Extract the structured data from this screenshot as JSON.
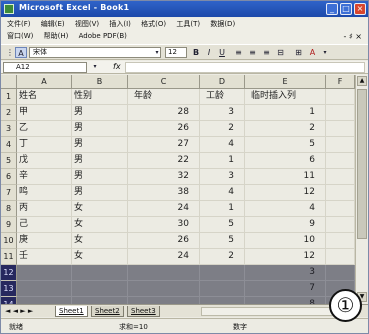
{
  "window": {
    "title": "Microsoft Excel - Book1",
    "min": "_",
    "max": "□",
    "close": "×"
  },
  "menu": {
    "row1": [
      "文件(F)",
      "编辑(E)",
      "视图(V)",
      "插入(I)",
      "格式(O)",
      "工具(T)",
      "数据(D)"
    ],
    "row2": [
      "窗口(W)",
      "帮助(H)",
      "Adobe PDF(B)"
    ],
    "extra": "- ♯ ×"
  },
  "toolbar": {
    "font_name": "宋体",
    "font_size": "12",
    "bold": "B",
    "italic": "I",
    "underline": "U"
  },
  "formula_bar": {
    "name_box": "A12",
    "fx": "fx",
    "formula": ""
  },
  "columns": [
    "A",
    "B",
    "C",
    "D",
    "E",
    "F"
  ],
  "rows": [
    {
      "n": "1",
      "a": "姓名",
      "b": "性别",
      "c": "年龄",
      "d": "工龄",
      "e": "临时插入列"
    },
    {
      "n": "2",
      "a": "甲",
      "b": "男",
      "c": "28",
      "d": "3",
      "e": "1"
    },
    {
      "n": "3",
      "a": "乙",
      "b": "男",
      "c": "26",
      "d": "2",
      "e": "2"
    },
    {
      "n": "4",
      "a": "丁",
      "b": "男",
      "c": "27",
      "d": "4",
      "e": "5"
    },
    {
      "n": "5",
      "a": "戊",
      "b": "男",
      "c": "22",
      "d": "1",
      "e": "6"
    },
    {
      "n": "6",
      "a": "辛",
      "b": "男",
      "c": "32",
      "d": "3",
      "e": "11"
    },
    {
      "n": "7",
      "a": "鸣",
      "b": "男",
      "c": "38",
      "d": "4",
      "e": "12"
    },
    {
      "n": "8",
      "a": "丙",
      "b": "女",
      "c": "24",
      "d": "1",
      "e": "4"
    },
    {
      "n": "9",
      "a": "己",
      "b": "女",
      "c": "30",
      "d": "5",
      "e": "9"
    },
    {
      "n": "10",
      "a": "庚",
      "b": "女",
      "c": "26",
      "d": "5",
      "e": "10"
    },
    {
      "n": "11",
      "a": "壬",
      "b": "女",
      "c": "24",
      "d": "2",
      "e": "12"
    },
    {
      "n": "12",
      "a": "",
      "b": "",
      "c": "",
      "d": "",
      "e": "3"
    },
    {
      "n": "13",
      "a": "",
      "b": "",
      "c": "",
      "d": "",
      "e": "7"
    },
    {
      "n": "14",
      "a": "",
      "b": "",
      "c": "",
      "d": "",
      "e": "8"
    }
  ],
  "sheet_tabs": [
    "Sheet1",
    "Sheet2",
    "Sheet3"
  ],
  "tab_nav": "◄ ◄ ► ►",
  "status": {
    "left": "就绪",
    "middle": "求和=10",
    "right": "数字"
  },
  "badge": "①"
}
